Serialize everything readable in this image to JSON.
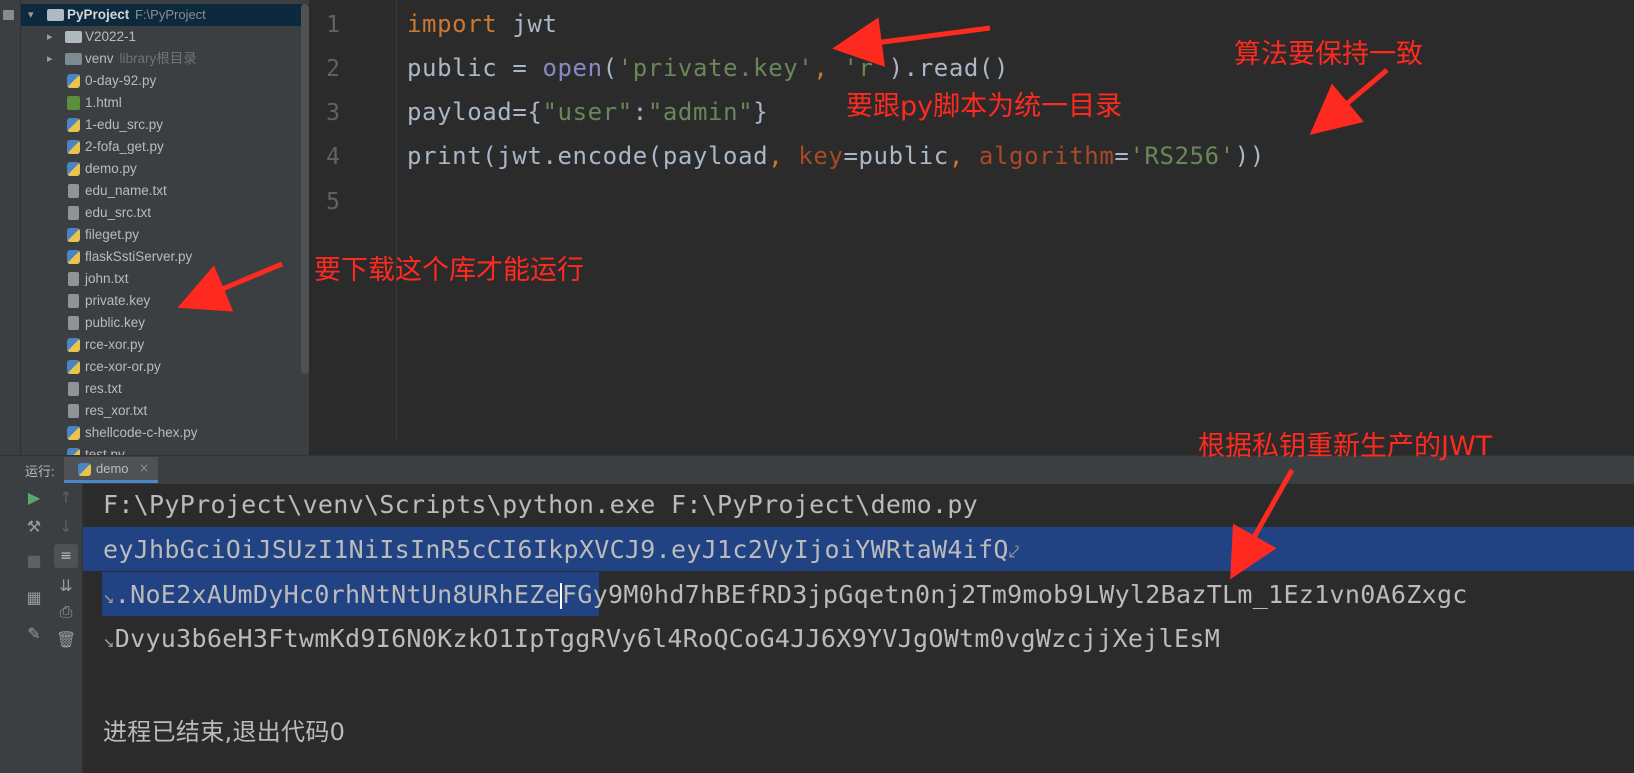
{
  "project_tree": {
    "root": {
      "name": "PyProject",
      "path": "F:\\PyProject"
    },
    "items": [
      {
        "label": "V2022-1",
        "type": "folder",
        "hint": ""
      },
      {
        "label": "venv",
        "type": "folder",
        "hint": "library根目录"
      },
      {
        "label": "0-day-92.py",
        "type": "py"
      },
      {
        "label": "1.html",
        "type": "html"
      },
      {
        "label": "1-edu_src.py",
        "type": "py"
      },
      {
        "label": "2-fofa_get.py",
        "type": "py"
      },
      {
        "label": "demo.py",
        "type": "py"
      },
      {
        "label": "edu_name.txt",
        "type": "txt"
      },
      {
        "label": "edu_src.txt",
        "type": "txt"
      },
      {
        "label": "fileget.py",
        "type": "py"
      },
      {
        "label": "flaskSstiServer.py",
        "type": "py"
      },
      {
        "label": "john.txt",
        "type": "txt"
      },
      {
        "label": "private.key",
        "type": "txt"
      },
      {
        "label": "public.key",
        "type": "txt"
      },
      {
        "label": "rce-xor.py",
        "type": "py"
      },
      {
        "label": "rce-xor-or.py",
        "type": "py"
      },
      {
        "label": "res.txt",
        "type": "txt"
      },
      {
        "label": "res_xor.txt",
        "type": "txt"
      },
      {
        "label": "shellcode-c-hex.py",
        "type": "py"
      },
      {
        "label": "test.py",
        "type": "py"
      }
    ]
  },
  "editor": {
    "line_numbers": [
      "1",
      "2",
      "3",
      "4",
      "5"
    ],
    "lines": {
      "l1": {
        "kw": "import",
        "rest": " jwt"
      },
      "l2": {
        "a": "public = ",
        "fn": "open",
        "b": "(",
        "s1": "'private.key'",
        "c": ", ",
        "s2": "'r'",
        "d": ").read()"
      },
      "l3": {
        "a": "payload=",
        "b": "{",
        "s1": "\"user\"",
        "c": ":",
        "s2": "\"admin\"",
        "d": "}"
      },
      "l4": {
        "a": "print(jwt.encode(payload",
        "c1": ", ",
        "p1": "key",
        "b": "=public",
        "c2": ", ",
        "p2": "algorithm",
        "e": "=",
        "s": "'RS256'",
        "d": "))"
      }
    }
  },
  "run_panel": {
    "label": "运行:",
    "tab": "demo",
    "tab_close": "×",
    "console": {
      "command": "F:\\PyProject\\venv\\Scripts\\python.exe F:\\PyProject\\demo.py",
      "jwt_line1": "eyJhbGciOiJSUzI1NiIsInR5cCI6IkpXVCJ9.eyJ1c2VyIjoiYWRtaW4ifQ",
      "jwt_line2_selected": ".NoE2xAUmDyHc0rhNtNtUn8URhEZe",
      "jwt_line2_rest": "FGy9M0hd7hBEfRD3jpGqetn0nj2Tm9mob9LWyl2BazTLm_1Ez1vn0A6Zxgc",
      "jwt_line3": "Dvyu3b6eH3FtwmKd9I6N0KzkO1IpTggRVy6l4RoQCoG4JJ6X9YVJgOWtm0vgWzcjjXejlEsM",
      "wrap_mark_end": "⤦",
      "wrap_mark_start": "↘",
      "exit": "进程已结束,退出代码0"
    }
  },
  "annotations": {
    "same_dir": "要跟py脚本为统一目录",
    "algo_same": "算法要保持一致",
    "download_lib": "要下载这个库才能运行",
    "regen_jwt": "根据私钥重新生产的JWT",
    "color": "#ff2a1f"
  }
}
